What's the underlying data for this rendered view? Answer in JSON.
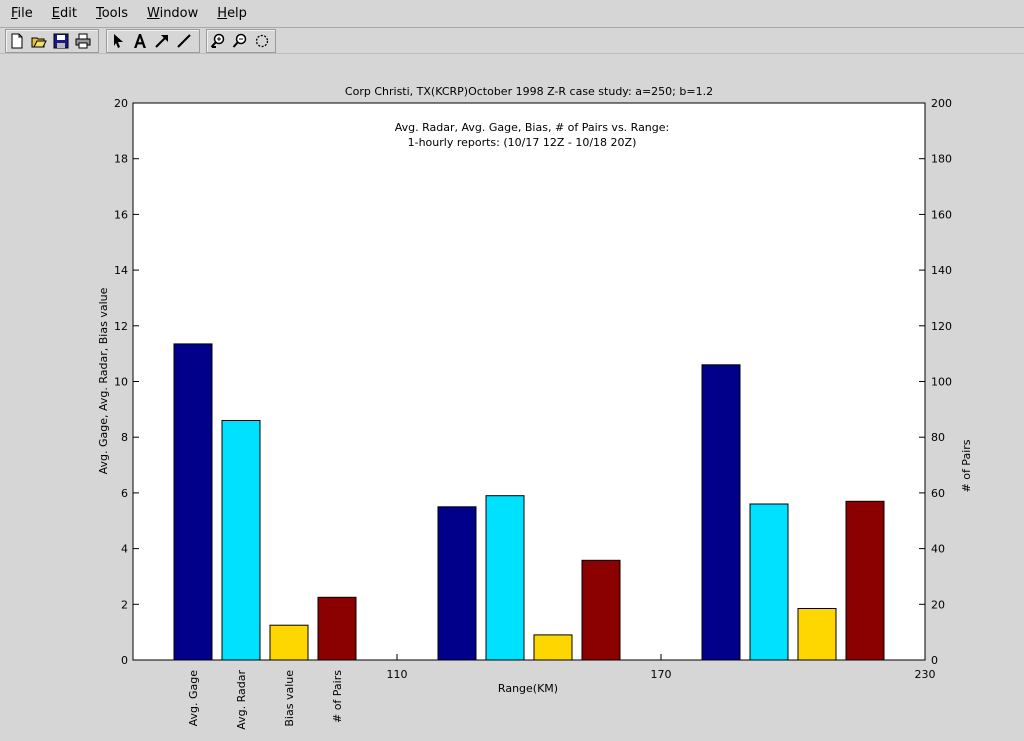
{
  "menu": {
    "items": [
      "File",
      "Edit",
      "Tools",
      "Window",
      "Help"
    ]
  },
  "toolbar": {
    "icons": [
      "new-file-icon",
      "open-folder-icon",
      "save-icon",
      "print-icon",
      "select-arrow-icon",
      "text-insert-icon",
      "arrow-insert-icon",
      "line-insert-icon",
      "zoom-in-icon",
      "zoom-out-icon",
      "rotate-icon"
    ]
  },
  "chart_data": {
    "type": "bar",
    "title": "Corp Christi, TX(KCRP)October 1998 Z-R case study: a=250; b=1.2",
    "annotation": [
      "Avg. Radar, Avg. Gage, Bias, # of Pairs vs. Range:",
      "1-hourly reports: (10/17 12Z - 10/18 20Z)"
    ],
    "xlabel": "Range(KM)",
    "ylabel_left": "Avg. Gage, Avg. Radar, Bias value",
    "ylabel_right": "# of Pairs",
    "ylim_left": [
      0,
      20
    ],
    "ylim_right": [
      0,
      200
    ],
    "yticks_left": [
      "0",
      "2",
      "4",
      "6",
      "8",
      "10",
      "12",
      "14",
      "16",
      "18",
      "20"
    ],
    "yticks_right": [
      "0",
      "20",
      "40",
      "60",
      "80",
      "100",
      "120",
      "140",
      "160",
      "180",
      "200"
    ],
    "x_range": [
      50,
      230
    ],
    "x_ticks": [
      {
        "value": 110,
        "label": "110"
      },
      {
        "value": 170,
        "label": "170"
      },
      {
        "value": 230,
        "label": "230"
      }
    ],
    "category_labels": [
      "Avg. Gage",
      "Avg. Radar",
      "Bias value",
      "# of Pairs"
    ],
    "colors": [
      "#00008b",
      "#00e0ff",
      "#ffd700",
      "#8b0000"
    ],
    "groups": [
      {
        "center": 80,
        "values": [
          11.35,
          8.6,
          1.25,
          22.5
        ]
      },
      {
        "center": 140,
        "values": [
          5.5,
          5.9,
          0.9,
          35.8
        ]
      },
      {
        "center": 200,
        "values": [
          10.6,
          5.6,
          1.85,
          57
        ]
      }
    ],
    "series_axis": [
      "left",
      "left",
      "left",
      "right"
    ]
  }
}
